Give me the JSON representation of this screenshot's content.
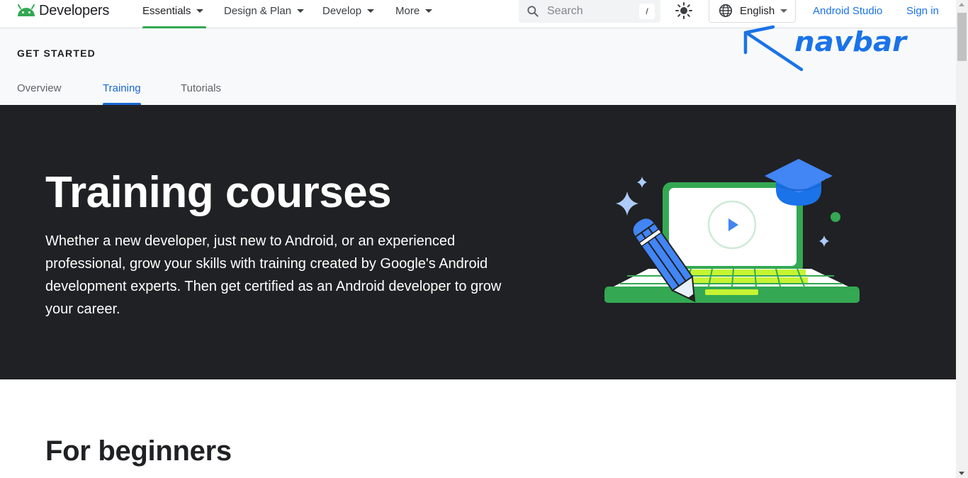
{
  "nav": {
    "logo_text": "Developers",
    "items": [
      {
        "label": "Essentials"
      },
      {
        "label": "Design & Plan"
      },
      {
        "label": "Develop"
      },
      {
        "label": "More"
      }
    ],
    "search_placeholder": "Search",
    "search_shortcut": "/",
    "language": "English",
    "android_studio": "Android Studio",
    "sign_in": "Sign in"
  },
  "subheader": {
    "section": "GET STARTED",
    "tabs": [
      {
        "label": "Overview"
      },
      {
        "label": "Training"
      },
      {
        "label": "Tutorials"
      }
    ]
  },
  "annotation": {
    "text": "navbar",
    "color": "#1a73e8"
  },
  "hero": {
    "title": "Training courses",
    "description": "Whether a new developer, just new to Android, or an experienced professional, grow your skills with training created by Google's Android development experts. Then get certified as an Android developer to grow your career."
  },
  "content": {
    "heading": "For beginners"
  },
  "colors": {
    "hero_bg": "#202124",
    "accent_green": "#34a853",
    "link_blue": "#1a73e8",
    "tab_active": "#1967d2"
  },
  "icons": [
    "android-logo-icon",
    "search-icon",
    "sun-icon",
    "globe-icon",
    "caret-down-icon",
    "play-icon",
    "graduation-cap-icon",
    "pencil-icon",
    "sparkle-icon"
  ]
}
